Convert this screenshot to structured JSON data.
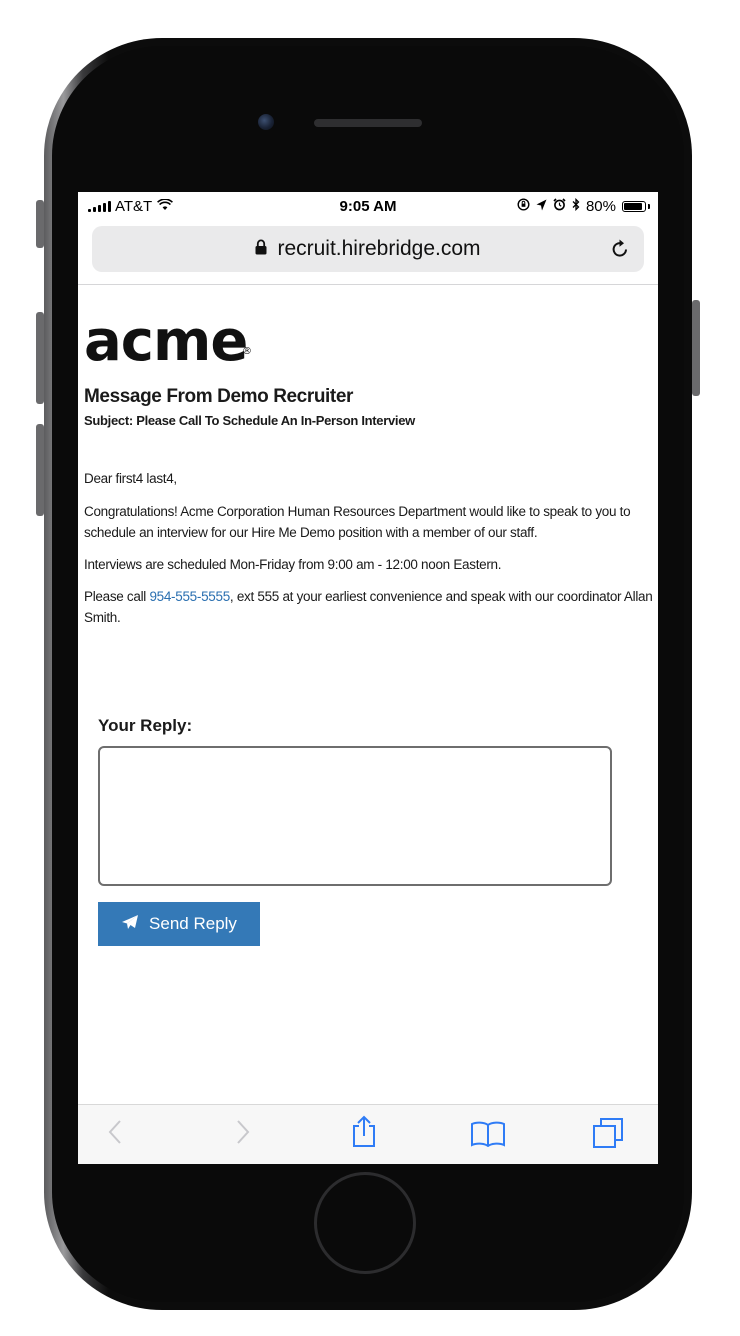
{
  "status_bar": {
    "carrier": "AT&T",
    "time": "9:05 AM",
    "battery": "80%"
  },
  "browser": {
    "url": "recruit.hirebridge.com"
  },
  "email": {
    "logo_text": "acme",
    "logo_mark": "®",
    "title": "Message From Demo Recruiter",
    "subject": "Subject: Please Call To Schedule An In-Person Interview",
    "greeting": "Dear first4 last4,",
    "paragraph1": "Congratulations! Acme Corporation Human Resources Department would like to speak to you to schedule an interview for our Hire Me Demo position with a member of our staff.",
    "paragraph2": "Interviews are scheduled Mon-Friday from 9:00 am - 12:00 noon Eastern.",
    "paragraph3_before": "Please call ",
    "phone": "954-555-5555",
    "paragraph3_after": ", ext 555 at your earliest convenience and speak with our coordinator Allan Smith."
  },
  "reply": {
    "label": "Your Reply:",
    "value": "",
    "send_label": "Send Reply"
  },
  "toolbar": {
    "icons": [
      "back-icon",
      "forward-icon",
      "share-icon",
      "bookmarks-icon",
      "tabs-icon"
    ]
  },
  "colors": {
    "link": "#2a6fb0",
    "button": "#3479b7",
    "toolbar_icon": "#2f7cf6"
  }
}
